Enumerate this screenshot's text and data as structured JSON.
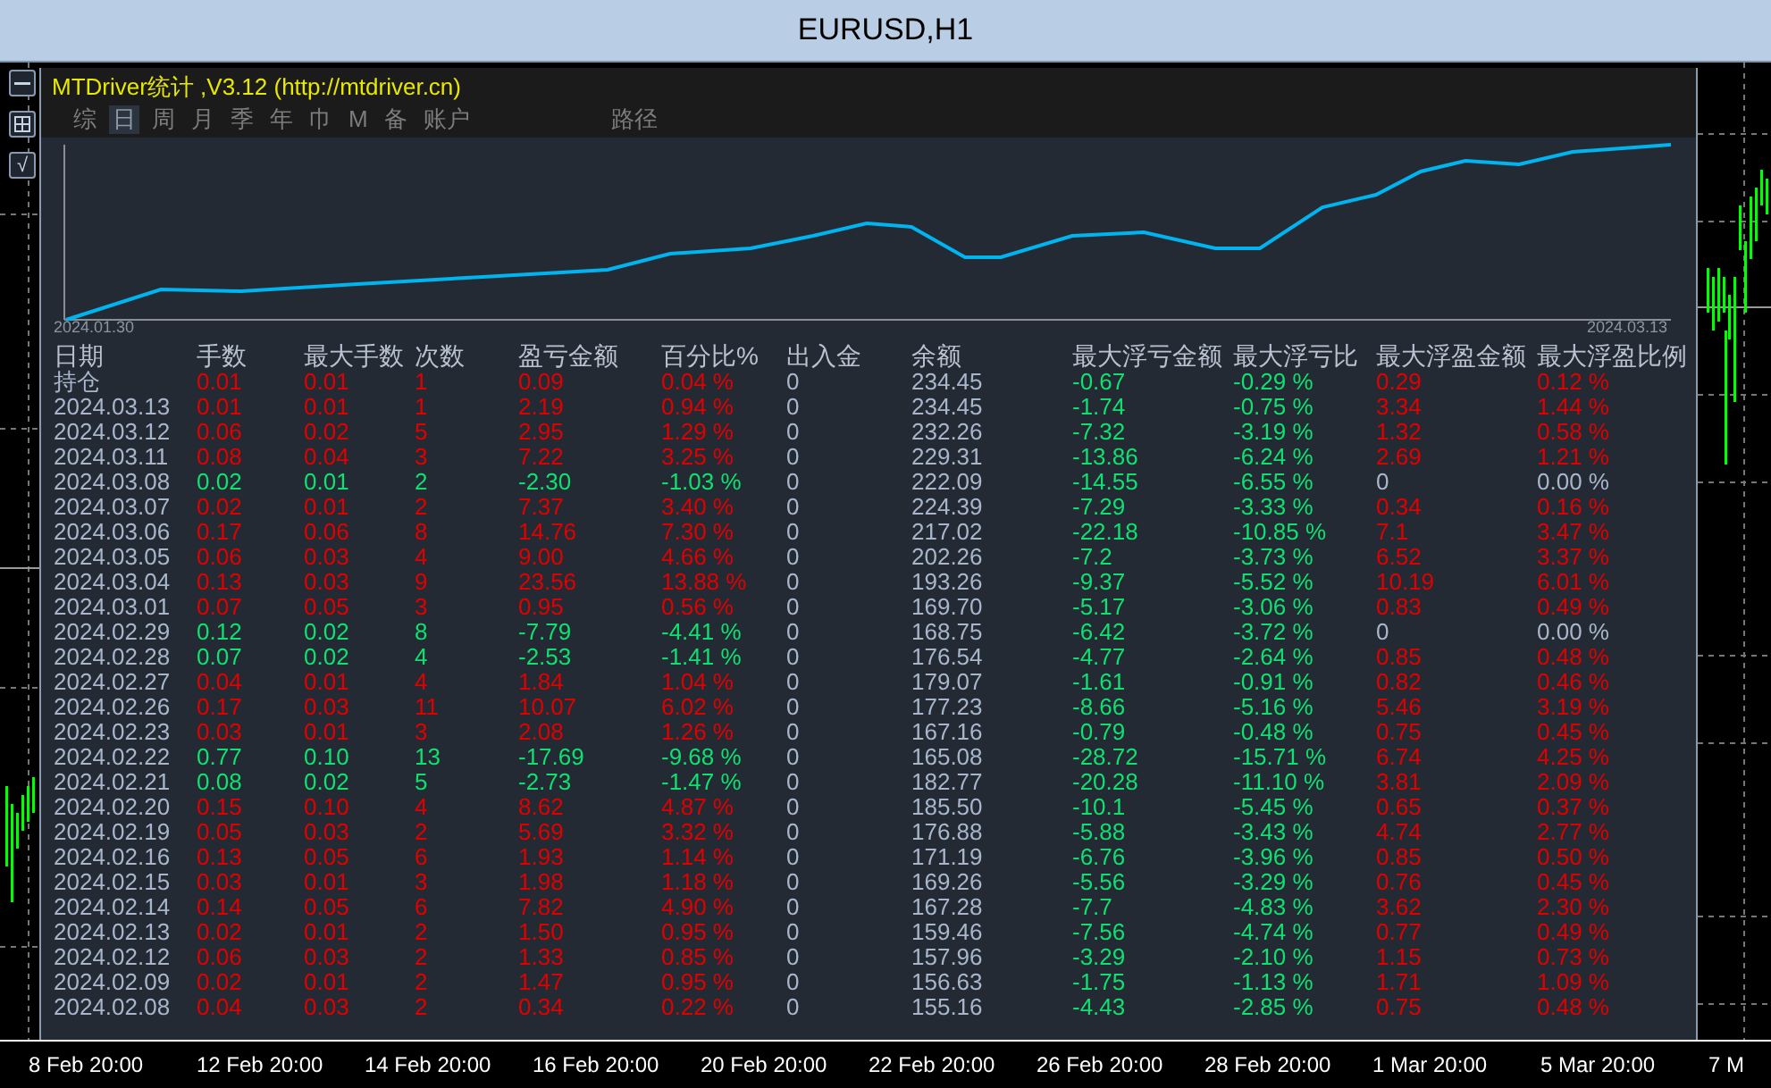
{
  "window": {
    "title": "EURUSD,H1"
  },
  "side_buttons": [
    {
      "kind": "minus"
    },
    {
      "kind": "grid"
    },
    {
      "kind": "text",
      "label": "√"
    }
  ],
  "panel": {
    "title": "MTDriver统计 ,V3.12 (http://mtdriver.cn)",
    "tabs": [
      {
        "label": "综",
        "selected": false
      },
      {
        "label": "日",
        "selected": true
      },
      {
        "label": "周",
        "selected": false
      },
      {
        "label": "月",
        "selected": false
      },
      {
        "label": "季",
        "selected": false
      },
      {
        "label": "年",
        "selected": false
      },
      {
        "label": "巾",
        "selected": false
      },
      {
        "label": "M",
        "selected": false
      },
      {
        "label": "备",
        "selected": false
      },
      {
        "label": "账户",
        "selected": false
      }
    ],
    "extra_tabs": [
      {
        "label": "路径",
        "selected": false
      }
    ],
    "equity_chart": {
      "start_label": "2024.01.30",
      "end_label": "2024.03.13"
    }
  },
  "table": {
    "columns": [
      "日期",
      "手数",
      "最大手数",
      "次数",
      "盈亏金额",
      "百分比%",
      "出入金",
      "余额",
      "最大浮亏金额",
      "最大浮亏比",
      "最大浮盈金额",
      "最大浮盈比例"
    ],
    "rows": [
      {
        "kind": "profit",
        "has_float_profit": true,
        "cells": [
          "持仓",
          "0.01",
          "0.01",
          "1",
          "0.09",
          "0.04 %",
          "0",
          "234.45",
          "-0.67",
          "-0.29 %",
          "0.29",
          "0.12 %"
        ]
      },
      {
        "kind": "profit",
        "has_float_profit": true,
        "cells": [
          "2024.03.13",
          "0.01",
          "0.01",
          "1",
          "2.19",
          "0.94 %",
          "0",
          "234.45",
          "-1.74",
          "-0.75 %",
          "3.34",
          "1.44 %"
        ]
      },
      {
        "kind": "profit",
        "has_float_profit": true,
        "cells": [
          "2024.03.12",
          "0.06",
          "0.02",
          "5",
          "2.95",
          "1.29 %",
          "0",
          "232.26",
          "-7.32",
          "-3.19 %",
          "1.32",
          "0.58 %"
        ]
      },
      {
        "kind": "profit",
        "has_float_profit": true,
        "cells": [
          "2024.03.11",
          "0.08",
          "0.04",
          "3",
          "7.22",
          "3.25 %",
          "0",
          "229.31",
          "-13.86",
          "-6.24 %",
          "2.69",
          "1.21 %"
        ]
      },
      {
        "kind": "loss",
        "has_float_profit": false,
        "cells": [
          "2024.03.08",
          "0.02",
          "0.01",
          "2",
          "-2.30",
          "-1.03 %",
          "0",
          "222.09",
          "-14.55",
          "-6.55 %",
          "0",
          "0.00 %"
        ]
      },
      {
        "kind": "profit",
        "has_float_profit": true,
        "cells": [
          "2024.03.07",
          "0.02",
          "0.01",
          "2",
          "7.37",
          "3.40 %",
          "0",
          "224.39",
          "-7.29",
          "-3.33 %",
          "0.34",
          "0.16 %"
        ]
      },
      {
        "kind": "profit",
        "has_float_profit": true,
        "cells": [
          "2024.03.06",
          "0.17",
          "0.06",
          "8",
          "14.76",
          "7.30 %",
          "0",
          "217.02",
          "-22.18",
          "-10.85 %",
          "7.1",
          "3.47 %"
        ]
      },
      {
        "kind": "profit",
        "has_float_profit": true,
        "cells": [
          "2024.03.05",
          "0.06",
          "0.03",
          "4",
          "9.00",
          "4.66 %",
          "0",
          "202.26",
          "-7.2",
          "-3.73 %",
          "6.52",
          "3.37 %"
        ]
      },
      {
        "kind": "profit",
        "has_float_profit": true,
        "cells": [
          "2024.03.04",
          "0.13",
          "0.03",
          "9",
          "23.56",
          "13.88 %",
          "0",
          "193.26",
          "-9.37",
          "-5.52 %",
          "10.19",
          "6.01 %"
        ]
      },
      {
        "kind": "profit",
        "has_float_profit": true,
        "cells": [
          "2024.03.01",
          "0.07",
          "0.05",
          "3",
          "0.95",
          "0.56 %",
          "0",
          "169.70",
          "-5.17",
          "-3.06 %",
          "0.83",
          "0.49 %"
        ]
      },
      {
        "kind": "loss",
        "has_float_profit": false,
        "cells": [
          "2024.02.29",
          "0.12",
          "0.02",
          "8",
          "-7.79",
          "-4.41 %",
          "0",
          "168.75",
          "-6.42",
          "-3.72 %",
          "0",
          "0.00 %"
        ]
      },
      {
        "kind": "loss",
        "has_float_profit": true,
        "cells": [
          "2024.02.28",
          "0.07",
          "0.02",
          "4",
          "-2.53",
          "-1.41 %",
          "0",
          "176.54",
          "-4.77",
          "-2.64 %",
          "0.85",
          "0.48 %"
        ]
      },
      {
        "kind": "profit",
        "has_float_profit": true,
        "cells": [
          "2024.02.27",
          "0.04",
          "0.01",
          "4",
          "1.84",
          "1.04 %",
          "0",
          "179.07",
          "-1.61",
          "-0.91 %",
          "0.82",
          "0.46 %"
        ]
      },
      {
        "kind": "profit",
        "has_float_profit": true,
        "cells": [
          "2024.02.26",
          "0.17",
          "0.03",
          "11",
          "10.07",
          "6.02 %",
          "0",
          "177.23",
          "-8.66",
          "-5.16 %",
          "5.46",
          "3.19 %"
        ]
      },
      {
        "kind": "profit",
        "has_float_profit": true,
        "cells": [
          "2024.02.23",
          "0.03",
          "0.01",
          "3",
          "2.08",
          "1.26 %",
          "0",
          "167.16",
          "-0.79",
          "-0.48 %",
          "0.75",
          "0.45 %"
        ]
      },
      {
        "kind": "loss",
        "has_float_profit": true,
        "cells": [
          "2024.02.22",
          "0.77",
          "0.10",
          "13",
          "-17.69",
          "-9.68 %",
          "0",
          "165.08",
          "-28.72",
          "-15.71 %",
          "6.74",
          "4.25 %"
        ]
      },
      {
        "kind": "loss",
        "has_float_profit": true,
        "cells": [
          "2024.02.21",
          "0.08",
          "0.02",
          "5",
          "-2.73",
          "-1.47 %",
          "0",
          "182.77",
          "-20.28",
          "-11.10 %",
          "3.81",
          "2.09 %"
        ]
      },
      {
        "kind": "profit",
        "has_float_profit": true,
        "cells": [
          "2024.02.20",
          "0.15",
          "0.10",
          "4",
          "8.62",
          "4.87 %",
          "0",
          "185.50",
          "-10.1",
          "-5.45 %",
          "0.65",
          "0.37 %"
        ]
      },
      {
        "kind": "profit",
        "has_float_profit": true,
        "cells": [
          "2024.02.19",
          "0.05",
          "0.03",
          "2",
          "5.69",
          "3.32 %",
          "0",
          "176.88",
          "-5.88",
          "-3.43 %",
          "4.74",
          "2.77 %"
        ]
      },
      {
        "kind": "profit",
        "has_float_profit": true,
        "cells": [
          "2024.02.16",
          "0.13",
          "0.05",
          "6",
          "1.93",
          "1.14 %",
          "0",
          "171.19",
          "-6.76",
          "-3.96 %",
          "0.85",
          "0.50 %"
        ]
      },
      {
        "kind": "profit",
        "has_float_profit": true,
        "cells": [
          "2024.02.15",
          "0.03",
          "0.01",
          "3",
          "1.98",
          "1.18 %",
          "0",
          "169.26",
          "-5.56",
          "-3.29 %",
          "0.76",
          "0.45 %"
        ]
      },
      {
        "kind": "profit",
        "has_float_profit": true,
        "cells": [
          "2024.02.14",
          "0.14",
          "0.05",
          "6",
          "7.82",
          "4.90 %",
          "0",
          "167.28",
          "-7.7",
          "-4.83 %",
          "3.62",
          "2.30 %"
        ]
      },
      {
        "kind": "profit",
        "has_float_profit": true,
        "cells": [
          "2024.02.13",
          "0.02",
          "0.01",
          "2",
          "1.50",
          "0.95 %",
          "0",
          "159.46",
          "-7.56",
          "-4.74 %",
          "0.77",
          "0.49 %"
        ]
      },
      {
        "kind": "profit",
        "has_float_profit": true,
        "cells": [
          "2024.02.12",
          "0.06",
          "0.03",
          "2",
          "1.33",
          "0.85 %",
          "0",
          "157.96",
          "-3.29",
          "-2.10 %",
          "1.15",
          "0.73 %"
        ]
      },
      {
        "kind": "profit",
        "has_float_profit": true,
        "cells": [
          "2024.02.09",
          "0.02",
          "0.01",
          "2",
          "1.47",
          "0.95 %",
          "0",
          "156.63",
          "-1.75",
          "-1.13 %",
          "1.71",
          "1.09 %"
        ]
      },
      {
        "kind": "profit",
        "has_float_profit": true,
        "cells": [
          "2024.02.08",
          "0.04",
          "0.03",
          "2",
          "0.34",
          "0.22 %",
          "0",
          "155.16",
          "-4.43",
          "-2.85 %",
          "0.75",
          "0.48 %"
        ]
      }
    ]
  },
  "time_axis": [
    "8 Feb 20:00",
    "12 Feb 20:00",
    "14 Feb 20:00",
    "16 Feb 20:00",
    "20 Feb 20:00",
    "22 Feb 20:00",
    "26 Feb 20:00",
    "28 Feb 20:00",
    "1 Mar 20:00",
    "5 Mar 20:00",
    "7 M"
  ]
}
